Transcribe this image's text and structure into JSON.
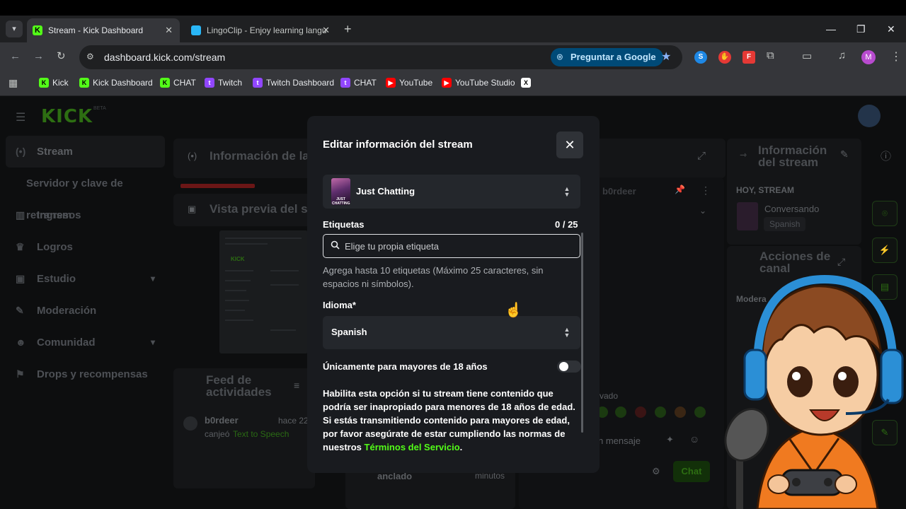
{
  "browser": {
    "tabs": [
      {
        "title": "Stream - Kick Dashboard",
        "active": true
      },
      {
        "title": "LingoClip - Enjoy learning langu",
        "active": false
      }
    ],
    "url": "dashboard.kick.com/stream",
    "ask_google": "Preguntar a Google",
    "profile_initial": "M",
    "bookmarks": [
      {
        "label": "Kick",
        "icon": "kick"
      },
      {
        "label": "Kick Dashboard",
        "icon": "kick"
      },
      {
        "label": "CHAT",
        "icon": "kick"
      },
      {
        "label": "Twitch",
        "icon": "twitch"
      },
      {
        "label": "Twitch Dashboard",
        "icon": "twitch"
      },
      {
        "label": "CHAT",
        "icon": "twitch"
      },
      {
        "label": "YouTube",
        "icon": "youtube"
      },
      {
        "label": "YouTube Studio",
        "icon": "youtube"
      },
      {
        "label": "",
        "icon": "x"
      }
    ]
  },
  "page": {
    "logo": "KICK",
    "logo_badge": "BETA",
    "sidebar": [
      {
        "label": "Stream",
        "icon": "broadcast-icon",
        "active": true
      },
      {
        "label": "Servidor y clave de retransm",
        "sub": true
      },
      {
        "label": "Ingresos",
        "icon": "chart-icon"
      },
      {
        "label": "Logros",
        "icon": "trophy-icon"
      },
      {
        "label": "Estudio",
        "icon": "studio-icon",
        "expandable": true
      },
      {
        "label": "Moderación",
        "icon": "wrench-icon"
      },
      {
        "label": "Comunidad",
        "icon": "people-icon",
        "expandable": true
      },
      {
        "label": "Drops y recompensas",
        "icon": "drops-icon"
      }
    ],
    "panels": {
      "stream_info_title": "Información de la",
      "preview_title": "Vista previa del s",
      "feed_title": "Feed de actividades",
      "feed_user": "b0rdeer",
      "feed_time": "hace 22",
      "feed_action": "canjeó",
      "feed_reward": "Text to Speech",
      "chat_user": "b0rdeer",
      "right_info_title": "Información del stream",
      "greeting": "HOY, STREAM",
      "category": "Conversando",
      "language_chip": "Spanish",
      "actions_title": "Acciones de canal",
      "chat_placeholder": "n mensaje",
      "chat_button": "Chat",
      "pinned_label": "anclado",
      "minutes_label": "minutos",
      "saved_label": "vado",
      "moderation_label": "Modera"
    }
  },
  "modal": {
    "title": "Editar información del stream",
    "category": {
      "name": "Just Chatting",
      "thumb_text": "JUST CHATTING"
    },
    "tags": {
      "label": "Etiquetas",
      "count": "0 / 25",
      "placeholder": "Elige tu propia etiqueta",
      "value": "",
      "help": "Agrega hasta 10 etiquetas (Máximo 25 caracteres, sin espacios ni símbolos)."
    },
    "language": {
      "label": "Idioma*",
      "value": "Spanish"
    },
    "adult": {
      "label": "Únicamente para mayores de 18 años",
      "enabled": false,
      "description": "Habilita esta opción si tu stream tiene contenido que podría ser inapropiado para menores de 18 años de edad. Si estás transmitiendo contenido para mayores de edad, por favor asegúrate de estar cumpliendo las normas de nuestros",
      "link": "Términos del Servicio",
      "end": "."
    }
  },
  "colors": {
    "kick_green": "#53fc18",
    "modal_bg": "#191b1f",
    "field_bg": "#24272c"
  }
}
